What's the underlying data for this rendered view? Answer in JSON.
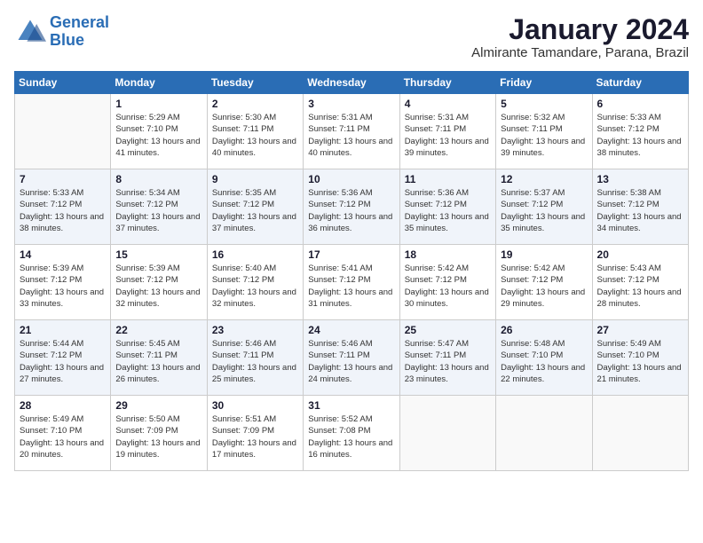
{
  "logo": {
    "line1": "General",
    "line2": "Blue"
  },
  "title": "January 2024",
  "location": "Almirante Tamandare, Parana, Brazil",
  "days_of_week": [
    "Sunday",
    "Monday",
    "Tuesday",
    "Wednesday",
    "Thursday",
    "Friday",
    "Saturday"
  ],
  "weeks": [
    [
      {
        "day": "",
        "sunrise": "",
        "sunset": "",
        "daylight": ""
      },
      {
        "day": "1",
        "sunrise": "5:29 AM",
        "sunset": "7:10 PM",
        "daylight": "13 hours and 41 minutes."
      },
      {
        "day": "2",
        "sunrise": "5:30 AM",
        "sunset": "7:11 PM",
        "daylight": "13 hours and 40 minutes."
      },
      {
        "day": "3",
        "sunrise": "5:31 AM",
        "sunset": "7:11 PM",
        "daylight": "13 hours and 40 minutes."
      },
      {
        "day": "4",
        "sunrise": "5:31 AM",
        "sunset": "7:11 PM",
        "daylight": "13 hours and 39 minutes."
      },
      {
        "day": "5",
        "sunrise": "5:32 AM",
        "sunset": "7:11 PM",
        "daylight": "13 hours and 39 minutes."
      },
      {
        "day": "6",
        "sunrise": "5:33 AM",
        "sunset": "7:12 PM",
        "daylight": "13 hours and 38 minutes."
      }
    ],
    [
      {
        "day": "7",
        "sunrise": "5:33 AM",
        "sunset": "7:12 PM",
        "daylight": "13 hours and 38 minutes."
      },
      {
        "day": "8",
        "sunrise": "5:34 AM",
        "sunset": "7:12 PM",
        "daylight": "13 hours and 37 minutes."
      },
      {
        "day": "9",
        "sunrise": "5:35 AM",
        "sunset": "7:12 PM",
        "daylight": "13 hours and 37 minutes."
      },
      {
        "day": "10",
        "sunrise": "5:36 AM",
        "sunset": "7:12 PM",
        "daylight": "13 hours and 36 minutes."
      },
      {
        "day": "11",
        "sunrise": "5:36 AM",
        "sunset": "7:12 PM",
        "daylight": "13 hours and 35 minutes."
      },
      {
        "day": "12",
        "sunrise": "5:37 AM",
        "sunset": "7:12 PM",
        "daylight": "13 hours and 35 minutes."
      },
      {
        "day": "13",
        "sunrise": "5:38 AM",
        "sunset": "7:12 PM",
        "daylight": "13 hours and 34 minutes."
      }
    ],
    [
      {
        "day": "14",
        "sunrise": "5:39 AM",
        "sunset": "7:12 PM",
        "daylight": "13 hours and 33 minutes."
      },
      {
        "day": "15",
        "sunrise": "5:39 AM",
        "sunset": "7:12 PM",
        "daylight": "13 hours and 32 minutes."
      },
      {
        "day": "16",
        "sunrise": "5:40 AM",
        "sunset": "7:12 PM",
        "daylight": "13 hours and 32 minutes."
      },
      {
        "day": "17",
        "sunrise": "5:41 AM",
        "sunset": "7:12 PM",
        "daylight": "13 hours and 31 minutes."
      },
      {
        "day": "18",
        "sunrise": "5:42 AM",
        "sunset": "7:12 PM",
        "daylight": "13 hours and 30 minutes."
      },
      {
        "day": "19",
        "sunrise": "5:42 AM",
        "sunset": "7:12 PM",
        "daylight": "13 hours and 29 minutes."
      },
      {
        "day": "20",
        "sunrise": "5:43 AM",
        "sunset": "7:12 PM",
        "daylight": "13 hours and 28 minutes."
      }
    ],
    [
      {
        "day": "21",
        "sunrise": "5:44 AM",
        "sunset": "7:12 PM",
        "daylight": "13 hours and 27 minutes."
      },
      {
        "day": "22",
        "sunrise": "5:45 AM",
        "sunset": "7:11 PM",
        "daylight": "13 hours and 26 minutes."
      },
      {
        "day": "23",
        "sunrise": "5:46 AM",
        "sunset": "7:11 PM",
        "daylight": "13 hours and 25 minutes."
      },
      {
        "day": "24",
        "sunrise": "5:46 AM",
        "sunset": "7:11 PM",
        "daylight": "13 hours and 24 minutes."
      },
      {
        "day": "25",
        "sunrise": "5:47 AM",
        "sunset": "7:11 PM",
        "daylight": "13 hours and 23 minutes."
      },
      {
        "day": "26",
        "sunrise": "5:48 AM",
        "sunset": "7:10 PM",
        "daylight": "13 hours and 22 minutes."
      },
      {
        "day": "27",
        "sunrise": "5:49 AM",
        "sunset": "7:10 PM",
        "daylight": "13 hours and 21 minutes."
      }
    ],
    [
      {
        "day": "28",
        "sunrise": "5:49 AM",
        "sunset": "7:10 PM",
        "daylight": "13 hours and 20 minutes."
      },
      {
        "day": "29",
        "sunrise": "5:50 AM",
        "sunset": "7:09 PM",
        "daylight": "13 hours and 19 minutes."
      },
      {
        "day": "30",
        "sunrise": "5:51 AM",
        "sunset": "7:09 PM",
        "daylight": "13 hours and 17 minutes."
      },
      {
        "day": "31",
        "sunrise": "5:52 AM",
        "sunset": "7:08 PM",
        "daylight": "13 hours and 16 minutes."
      },
      {
        "day": "",
        "sunrise": "",
        "sunset": "",
        "daylight": ""
      },
      {
        "day": "",
        "sunrise": "",
        "sunset": "",
        "daylight": ""
      },
      {
        "day": "",
        "sunrise": "",
        "sunset": "",
        "daylight": ""
      }
    ]
  ]
}
